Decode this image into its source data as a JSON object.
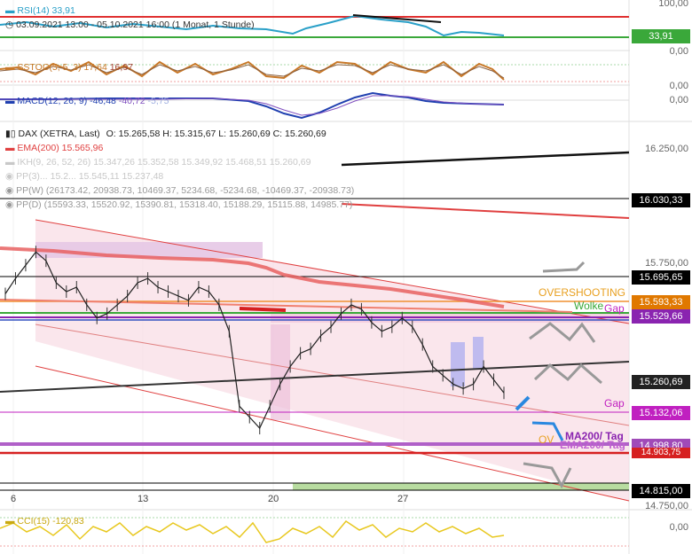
{
  "indicators": {
    "rsi": {
      "label": "RSI(14)",
      "value": "33,91"
    },
    "sstoc": {
      "label": "SSTOC(5, 5, 3)",
      "v1": "17,64",
      "v2": "16,97"
    },
    "macd": {
      "label": "MACD(12, 26, 9)",
      "v1": "-46,48",
      "v2": "-40,72",
      "v3": "-5,75"
    },
    "cci": {
      "label": "CCI(15)",
      "value": "-120,83"
    }
  },
  "range_text": "03.09.2021 13:00 - 05.10.2021 16:00",
  "range_note": "(1 Monat, 1 Stunde)",
  "instrument": {
    "name": "DAX (XETRA, Last)",
    "ohlc": "O: 15.265,58  H: 15.315,67  L: 15.260,69  C: 15.260,69"
  },
  "overlays": {
    "ema": "EMA(200)  15.565,96",
    "ikh": "IKH(9, 26, 52, 26)  15.347,26",
    "ikh_extra": "15.352,58  15.349,92  15.468,51  15.260,69",
    "pp_faded": "PP(3)...  15.2... 15.545,11  15.237,48",
    "ppw": "PP(W)  (26173.42, 20938.73, 10469.37, 5234.68, -5234.68, -10469.37, -20938.73)",
    "ppd": "PP(D)  (15593.33, 15520.92, 15390.81, 15318.40, 15188.29, 15115.88, 14985.77)"
  },
  "annotations": {
    "overshooting": "OVERSHOOTING",
    "wolke": "Wolke",
    "gap_upper": "Gap",
    "gap_lower": "Gap",
    "ma200_tag": "MA200/ Tag",
    "ema200_tag": "EMA200/ Tag",
    "ov": "OV"
  },
  "price_tags": [
    {
      "text": "33,91",
      "color": "#3aa83a"
    },
    {
      "text": "16.030,33",
      "color": "#000000"
    },
    {
      "text": "15.695,65",
      "color": "#000000"
    },
    {
      "text": "15.593,33",
      "color": "#e07800"
    },
    {
      "text": "15.529,66",
      "color": "#8a24b0"
    },
    {
      "text": "15.260,69",
      "color": "#222222"
    },
    {
      "text": "15.132,06",
      "color": "#c020c0"
    },
    {
      "text": "14.998,80",
      "color": "#a04ab8"
    },
    {
      "text": "14.903,75",
      "color": "#d62020"
    },
    {
      "text": "14.815,00",
      "color": "#000000"
    }
  ],
  "right_axis": {
    "rsi": [
      "100,00",
      "0,00"
    ],
    "sstoc": [
      "0,00"
    ],
    "macd": [
      "0,00"
    ],
    "price": [
      "16.250,00",
      "15.750,00",
      "14.750,00"
    ],
    "cci": [
      "0,00"
    ]
  },
  "x_labels": [
    "6",
    "13",
    "20",
    "27"
  ],
  "colors": {
    "rsi": "#2aa0c8",
    "sstoc": "#c87828",
    "macd": "#2040b0",
    "ema": "#e05050",
    "channel": "#e04040",
    "cci": "#e8c820",
    "grid": "#eeeeee"
  },
  "chart_data": {
    "type": "line",
    "title": "DAX (XETRA, Last)",
    "x_ticks": [
      "6",
      "13",
      "20",
      "27"
    ],
    "y_ticks": [
      "16.250,00",
      "15.750,00",
      "14.750,00"
    ],
    "ylim": [
      14750,
      16400
    ],
    "close_series": [
      15710,
      15780,
      15840,
      15900,
      15860,
      15760,
      15720,
      15740,
      15660,
      15600,
      15620,
      15660,
      15700,
      15760,
      15780,
      15740,
      15720,
      15700,
      15680,
      15740,
      15720,
      15660,
      15540,
      15200,
      15150,
      15100,
      15200,
      15300,
      15380,
      15440,
      15460,
      15520,
      15560,
      15620,
      15660,
      15640,
      15580,
      15540,
      15560,
      15600,
      15560,
      15480,
      15380,
      15340,
      15300,
      15280,
      15300,
      15380,
      15320,
      15260
    ],
    "levels": [
      16030.33,
      15695.65,
      15593.33,
      15529.66,
      15260.69,
      15132.06,
      14998.8,
      14903.75,
      14815.0
    ]
  }
}
